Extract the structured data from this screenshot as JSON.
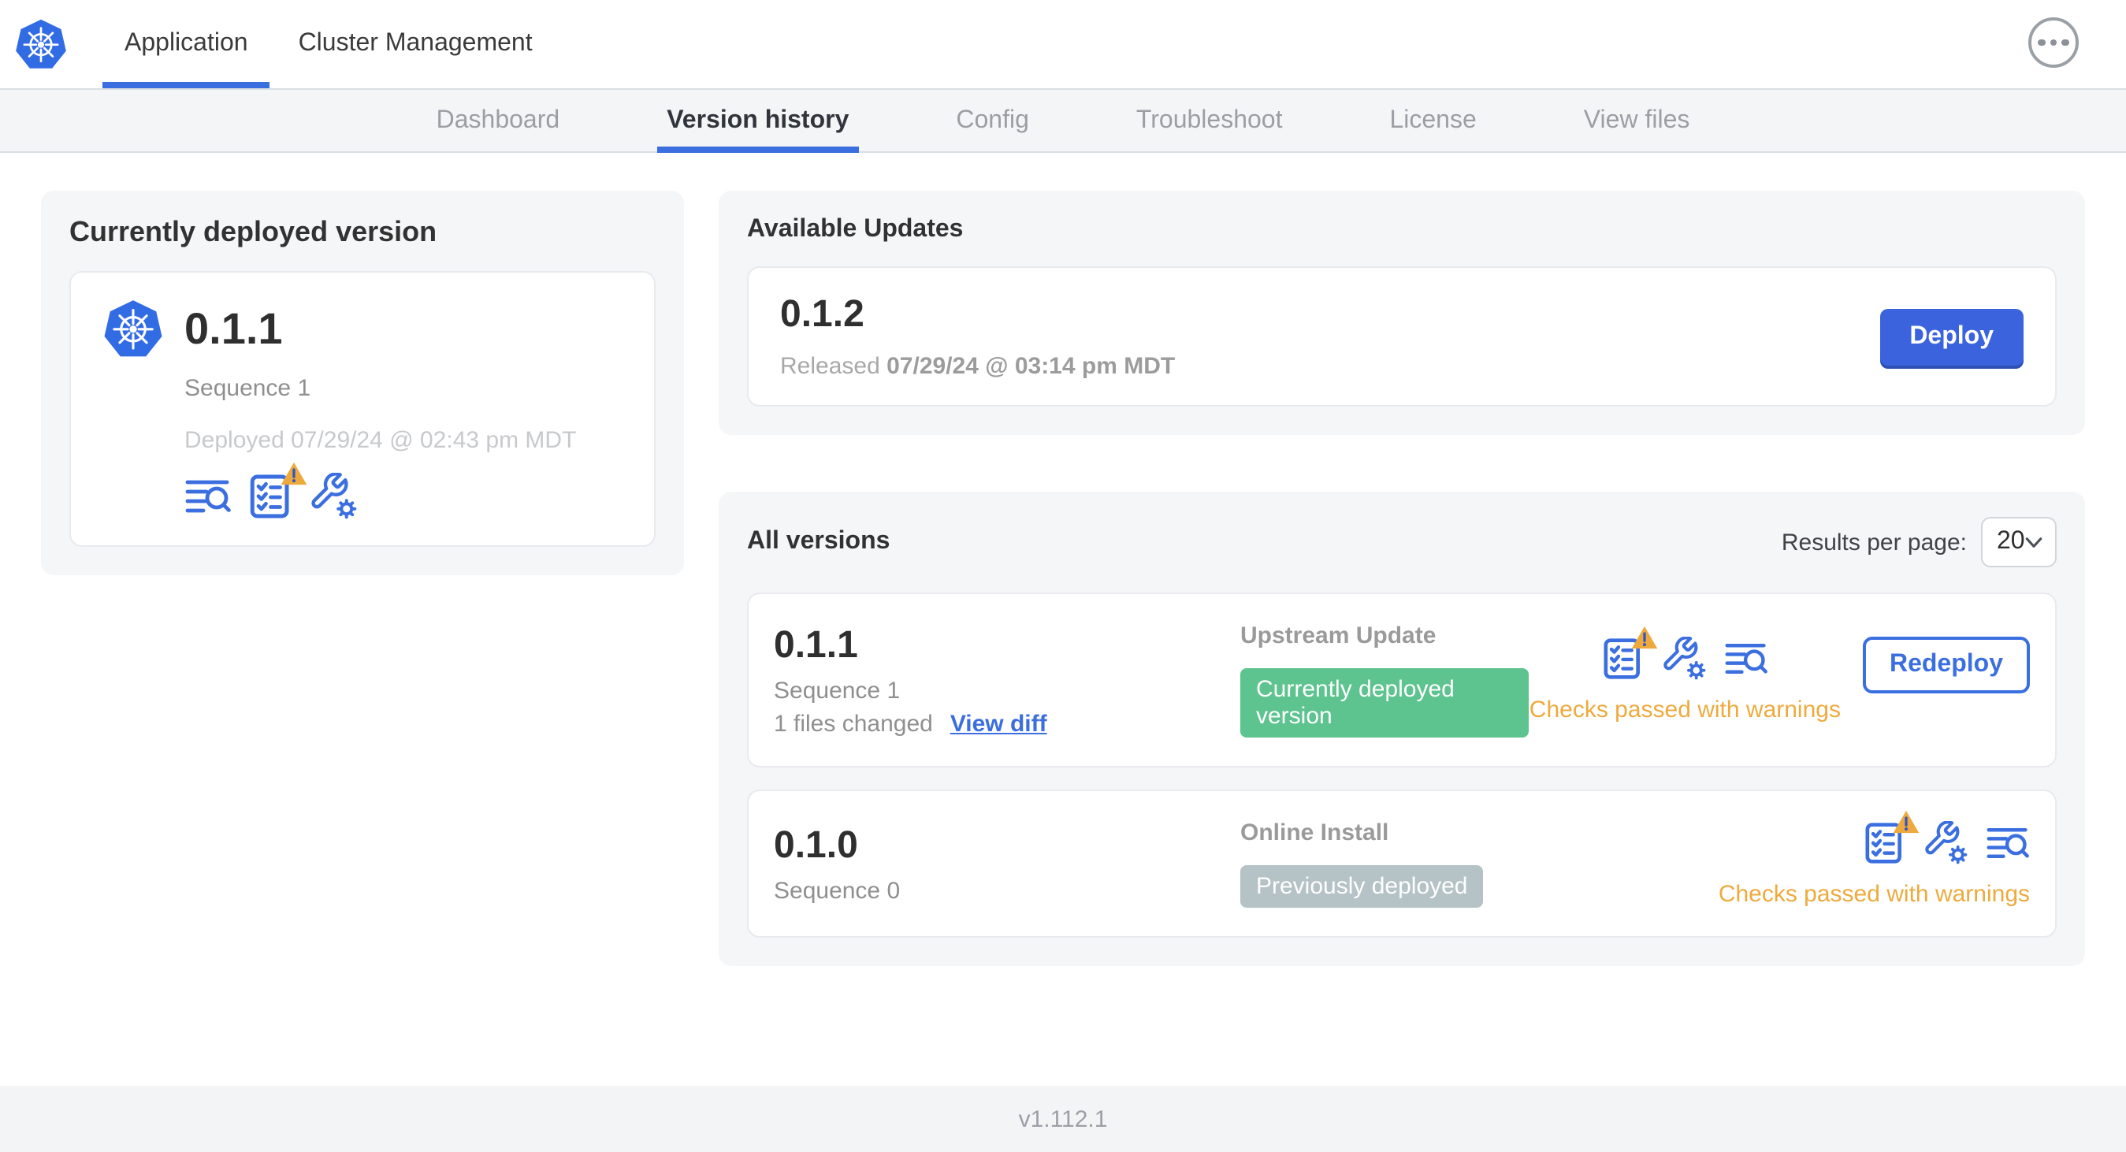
{
  "header": {
    "tabs": [
      {
        "label": "Application",
        "active": true
      },
      {
        "label": "Cluster Management",
        "active": false
      }
    ],
    "menu_icon": "ellipsis-menu-icon"
  },
  "subnav": {
    "tabs": [
      "Dashboard",
      "Version history",
      "Config",
      "Troubleshoot",
      "License",
      "View files"
    ],
    "active": "Version history"
  },
  "current": {
    "title": "Currently deployed version",
    "version": "0.1.1",
    "sequence": "Sequence 1",
    "deployed": "Deployed 07/29/24 @ 02:43 pm MDT",
    "icons": [
      "diff-icon",
      "preflight-checks-warning-icon",
      "config-icon"
    ]
  },
  "updates": {
    "title": "Available Updates",
    "version": "0.1.2",
    "released_label": "Released",
    "released_date": "07/29/24 @ 03:14 pm MDT",
    "deploy": "Deploy"
  },
  "versions": {
    "title": "All versions",
    "per_page_label": "Results per page:",
    "per_page": "20",
    "rows": [
      {
        "version": "0.1.1",
        "sequence": "Sequence 1",
        "files": "1 files changed",
        "diff": "View diff",
        "source": "Upstream Update",
        "badge": "Currently deployed version",
        "badge_color": "#5dc38f",
        "status": "Checks passed with warnings",
        "action": "Redeploy"
      },
      {
        "version": "0.1.0",
        "sequence": "Sequence 0",
        "source": "Online Install",
        "badge": "Previously deployed",
        "badge_color": "#b5c2c6",
        "status": "Checks passed with warnings"
      }
    ]
  },
  "footer": {
    "version": "v1.112.1"
  },
  "colors": {
    "accent_blue": "#3b6fe0",
    "button_blue": "#3b63de",
    "k8s_blue": "#326CE5",
    "badge_green": "#5dc38f",
    "badge_gray": "#b5c2c6",
    "warning_amber": "#eda93c"
  }
}
